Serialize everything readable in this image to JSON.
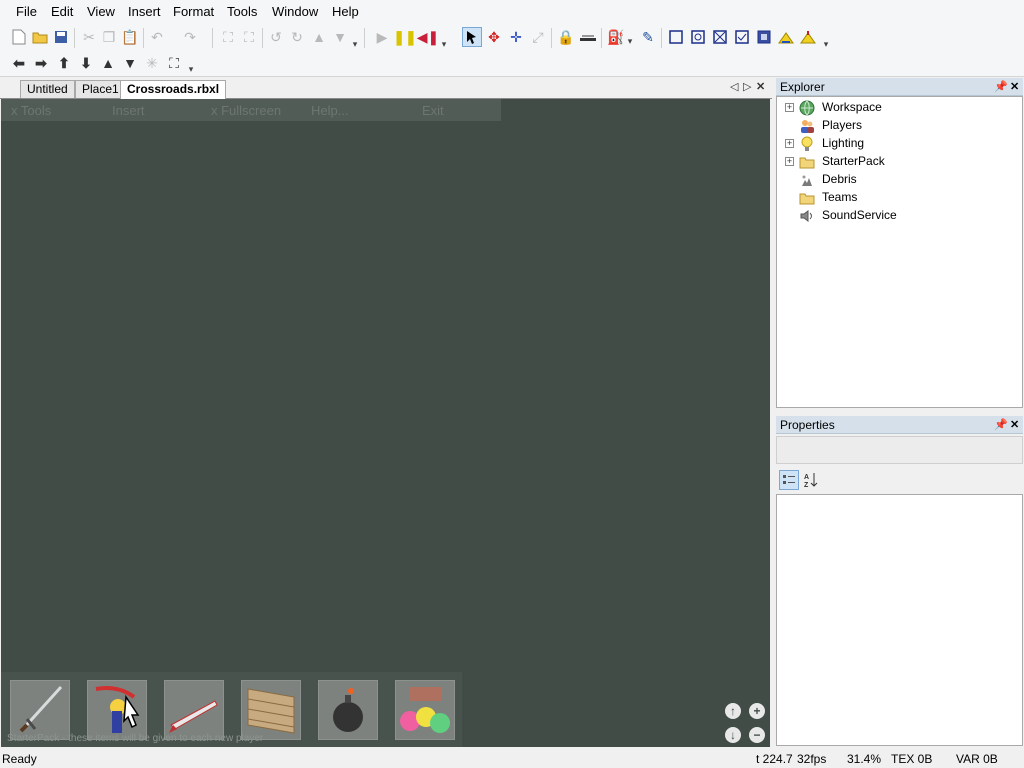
{
  "menu": [
    "File",
    "Edit",
    "View",
    "Insert",
    "Format",
    "Tools",
    "Window",
    "Help"
  ],
  "tabs": {
    "items": [
      "Untitled",
      "Place1",
      "Crossroads.rbxl"
    ],
    "active": 2
  },
  "game_menu": [
    "x Tools",
    "Insert",
    "x Fullscreen",
    "Help...",
    "Exit"
  ],
  "hotbar": {
    "hint": "StarterPack - these items will be given to each new player",
    "slots": [
      "sword-icon",
      "slingshot-icon",
      "rocket-icon",
      "brick-wall-icon",
      "bomb-icon",
      "paintball-icon"
    ]
  },
  "explorer": {
    "title": "Explorer",
    "items": [
      {
        "label": "Workspace",
        "icon": "globe-icon",
        "expandable": true
      },
      {
        "label": "Players",
        "icon": "players-icon",
        "expandable": false
      },
      {
        "label": "Lighting",
        "icon": "lightbulb-icon",
        "expandable": true
      },
      {
        "label": "StarterPack",
        "icon": "folder-icon",
        "expandable": true
      },
      {
        "label": "Debris",
        "icon": "debris-icon",
        "expandable": false
      },
      {
        "label": "Teams",
        "icon": "folder-icon",
        "expandable": false
      },
      {
        "label": "SoundService",
        "icon": "speaker-icon",
        "expandable": false
      }
    ]
  },
  "properties": {
    "title": "Properties"
  },
  "status": {
    "left": "Ready",
    "t": "t 224.7",
    "fps": "32fps",
    "pct": "31.4%",
    "tex": "TEX 0B",
    "var": "VAR 0B"
  },
  "colors": {
    "viewport": "#404c45",
    "panel_header": "#d5e0ea",
    "play_green": "#1e9e3a",
    "pause_yellow": "#d8c400",
    "stop_red": "#c8203a"
  },
  "glyphs": {
    "pin": "📌",
    "close": "✕",
    "expand": "+",
    "arrow_left": "◁",
    "arrow_right": "▷",
    "cam_up": "↑",
    "cam_down": "↓",
    "zoom_in": "+",
    "zoom_out": "−",
    "grip": "▾"
  }
}
